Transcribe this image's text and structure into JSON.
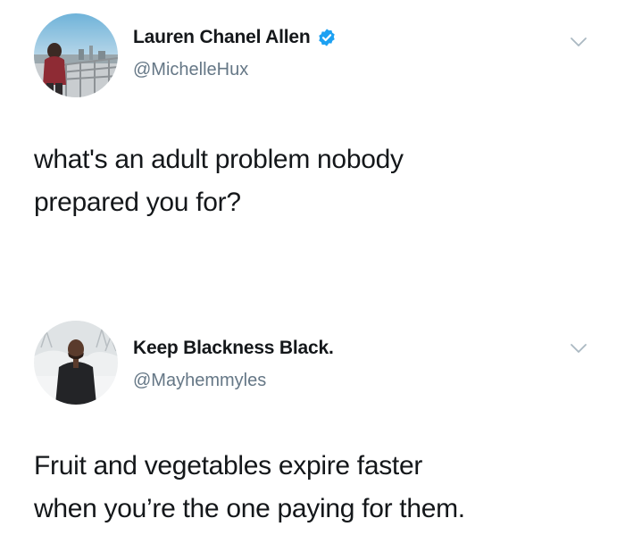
{
  "tweets": [
    {
      "display_name": "Lauren Chanel Allen",
      "handle": "@MichelleHux",
      "verified": true,
      "text_lines": [
        "what's an adult problem nobody",
        "prepared you for?"
      ]
    },
    {
      "display_name": "Keep Blackness Black.",
      "handle": "@Mayhemmyles",
      "verified": false,
      "text_lines": [
        "Fruit and vegetables expire faster",
        "when you’re the one paying for them."
      ]
    }
  ],
  "colors": {
    "text": "#14171a",
    "secondary": "#657786",
    "verified_blue": "#1da1f2",
    "chevron": "#aab8c2"
  },
  "icons": {
    "verified": "verified-badge-icon",
    "menu": "chevron-down-icon"
  }
}
